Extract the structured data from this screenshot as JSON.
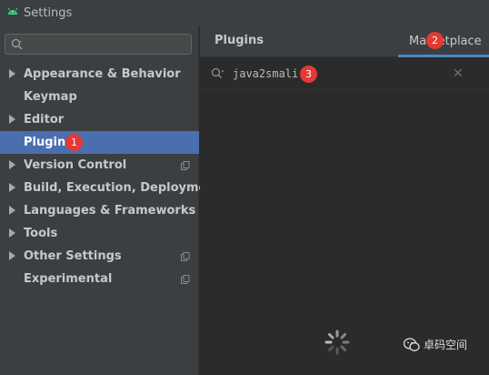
{
  "window": {
    "title": "Settings",
    "app_icon": "android-icon"
  },
  "sidebar": {
    "search": {
      "value": "",
      "placeholder": ""
    },
    "items": [
      {
        "label": "Appearance & Behavior",
        "expandable": true,
        "copy_icon": false
      },
      {
        "label": "Keymap",
        "expandable": false,
        "copy_icon": false
      },
      {
        "label": "Editor",
        "expandable": true,
        "copy_icon": false
      },
      {
        "label": "Plugins",
        "expandable": false,
        "copy_icon": false,
        "selected": true
      },
      {
        "label": "Version Control",
        "expandable": true,
        "copy_icon": true
      },
      {
        "label": "Build, Execution, Deployment",
        "expandable": true,
        "copy_icon": false
      },
      {
        "label": "Languages & Frameworks",
        "expandable": true,
        "copy_icon": false
      },
      {
        "label": "Tools",
        "expandable": true,
        "copy_icon": false
      },
      {
        "label": "Other Settings",
        "expandable": true,
        "copy_icon": true
      },
      {
        "label": "Experimental",
        "expandable": false,
        "copy_icon": true
      }
    ]
  },
  "main": {
    "title": "Plugins",
    "tabs": [
      {
        "label": "Marketplace",
        "active": true
      }
    ],
    "search": {
      "value": "java2smali",
      "placeholder": ""
    },
    "loading": true
  },
  "annotations": [
    "1",
    "2",
    "3"
  ],
  "watermark": {
    "label": "卓码空间",
    "icon": "wechat-icon"
  },
  "colors": {
    "sidebar_bg": "#3c3f41",
    "content_bg": "#2b2b2b",
    "selection": "#4b6eaf",
    "tab_underline": "#4a88c7",
    "badge": "#e53935",
    "android_green": "#3ddc84"
  }
}
